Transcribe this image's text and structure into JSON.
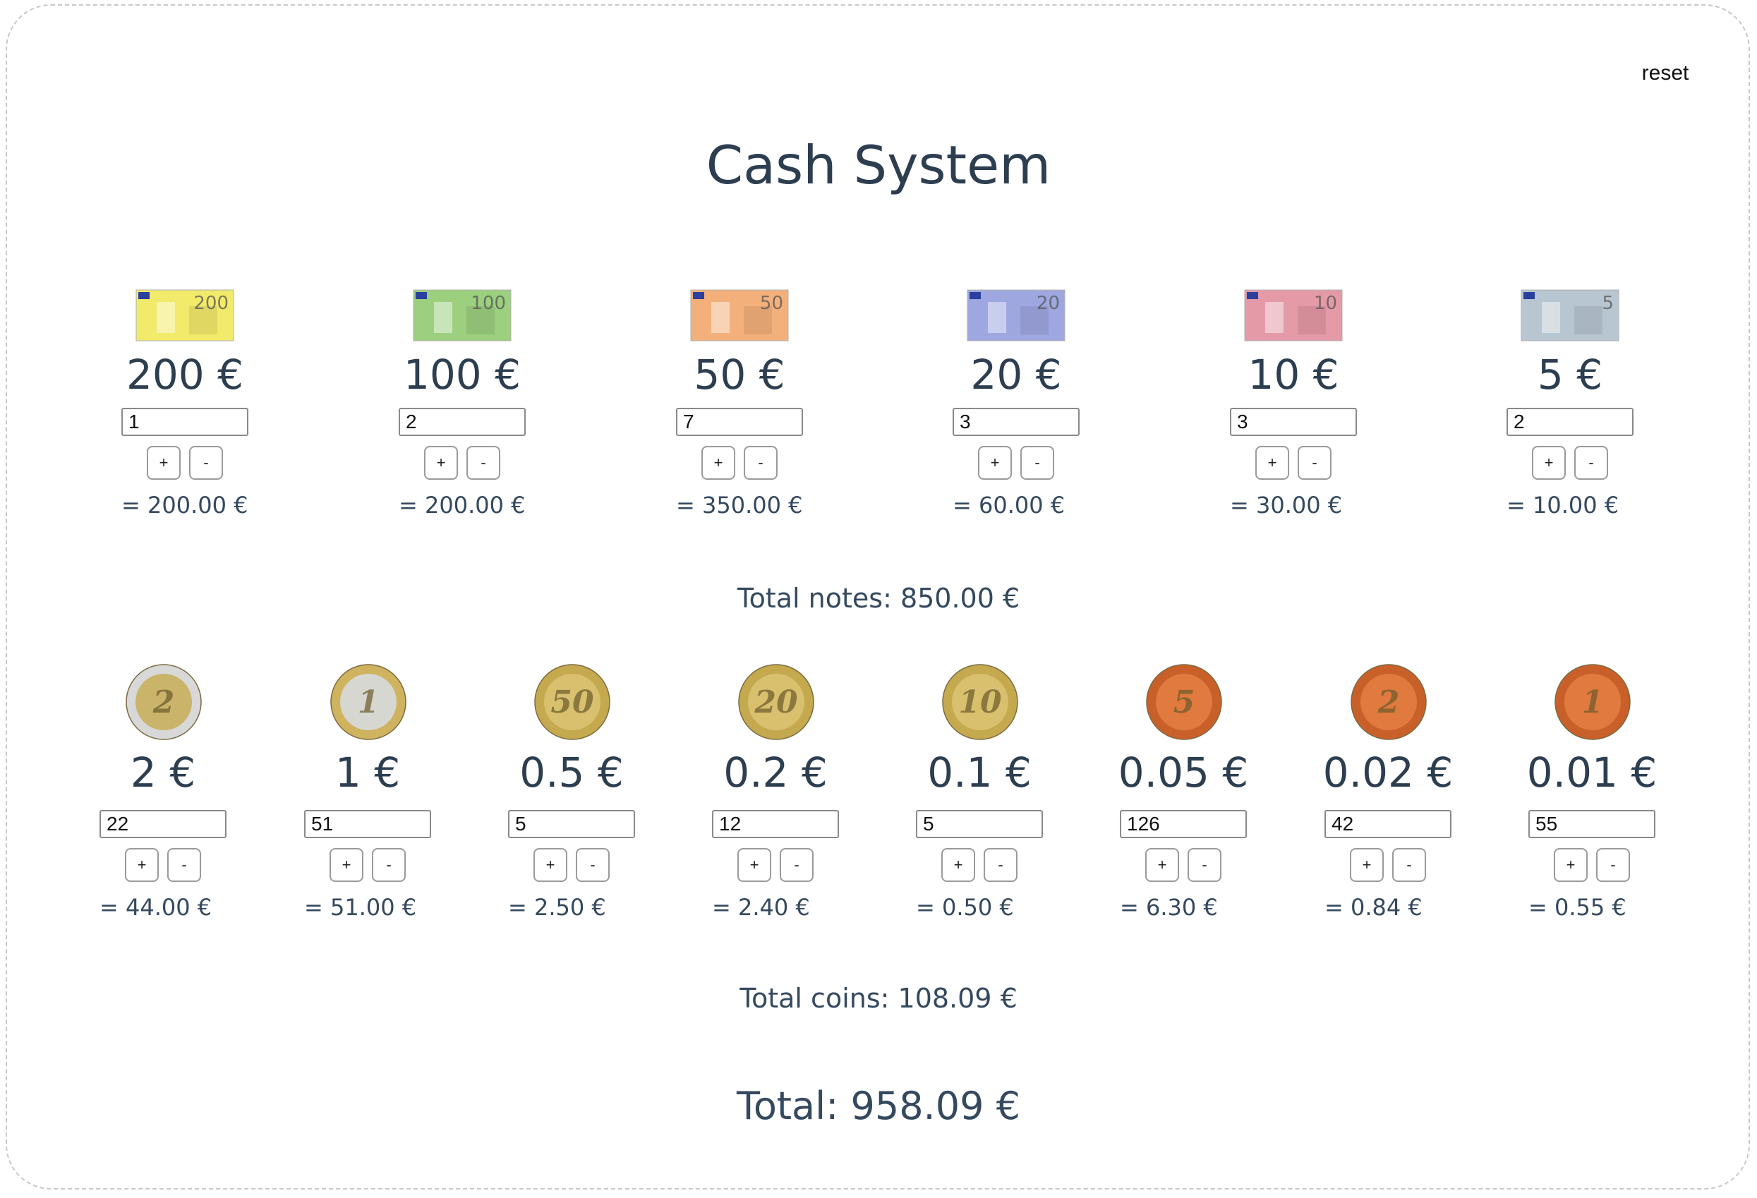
{
  "header": {
    "reset_label": "reset",
    "title": "Cash System"
  },
  "notes": [
    {
      "label": "200 €",
      "quantity": "1",
      "subtotal": "= 200.00 €",
      "picture_text": "200",
      "icon": "banknote-200-icon",
      "color": "#f2ea6a"
    },
    {
      "label": "100 €",
      "quantity": "2",
      "subtotal": "= 200.00 €",
      "picture_text": "100",
      "icon": "banknote-100-icon",
      "color": "#9ccf7e"
    },
    {
      "label": "50 €",
      "quantity": "7",
      "subtotal": "= 350.00 €",
      "picture_text": "50",
      "icon": "banknote-50-icon",
      "color": "#f4b07a"
    },
    {
      "label": "20 €",
      "quantity": "3",
      "subtotal": "= 60.00 €",
      "picture_text": "20",
      "icon": "banknote-20-icon",
      "color": "#9fa7e0"
    },
    {
      "label": "10 €",
      "quantity": "3",
      "subtotal": "= 30.00 €",
      "picture_text": "10",
      "icon": "banknote-10-icon",
      "color": "#e59aa8"
    },
    {
      "label": "5 €",
      "quantity": "2",
      "subtotal": "= 10.00 €",
      "picture_text": "5",
      "icon": "banknote-5-icon",
      "color": "#b8c6d2"
    }
  ],
  "notes_total": "Total notes: 850.00 €",
  "coins": [
    {
      "label": "2 €",
      "quantity": "22",
      "subtotal": "= 44.00 €",
      "picture_text": "2",
      "icon": "coin-2-euro-icon",
      "color": "#c9b46a",
      "ring": "#d8d8d8"
    },
    {
      "label": "1 €",
      "quantity": "51",
      "subtotal": "= 51.00 €",
      "picture_text": "1",
      "icon": "coin-1-euro-icon",
      "color": "#d7d7d2",
      "ring": "#cfb35e"
    },
    {
      "label": "0.5 €",
      "quantity": "5",
      "subtotal": "= 2.50 €",
      "picture_text": "50",
      "icon": "coin-50-cent-icon",
      "color": "#d9c06f",
      "ring": "#c5a94f"
    },
    {
      "label": "0.2 €",
      "quantity": "12",
      "subtotal": "= 2.40 €",
      "picture_text": "20",
      "icon": "coin-20-cent-icon",
      "color": "#d9c06f",
      "ring": "#c5a94f"
    },
    {
      "label": "0.1 €",
      "quantity": "5",
      "subtotal": "= 0.50 €",
      "picture_text": "10",
      "icon": "coin-10-cent-icon",
      "color": "#d9c06f",
      "ring": "#c5a94f"
    },
    {
      "label": "0.05 €",
      "quantity": "126",
      "subtotal": "= 6.30 €",
      "picture_text": "5",
      "icon": "coin-5-cent-icon",
      "color": "#e07a3e",
      "ring": "#c9602a"
    },
    {
      "label": "0.02 €",
      "quantity": "42",
      "subtotal": "= 0.84 €",
      "picture_text": "2",
      "icon": "coin-2-cent-icon",
      "color": "#e07a3e",
      "ring": "#c9602a"
    },
    {
      "label": "0.01 €",
      "quantity": "55",
      "subtotal": "= 0.55 €",
      "picture_text": "1",
      "icon": "coin-1-cent-icon",
      "color": "#e07a3e",
      "ring": "#c9602a"
    }
  ],
  "coins_total": "Total coins: 108.09 €",
  "grand_total": "Total: 958.09 €",
  "stepper": {
    "plus_label": "+",
    "minus_label": "-"
  }
}
